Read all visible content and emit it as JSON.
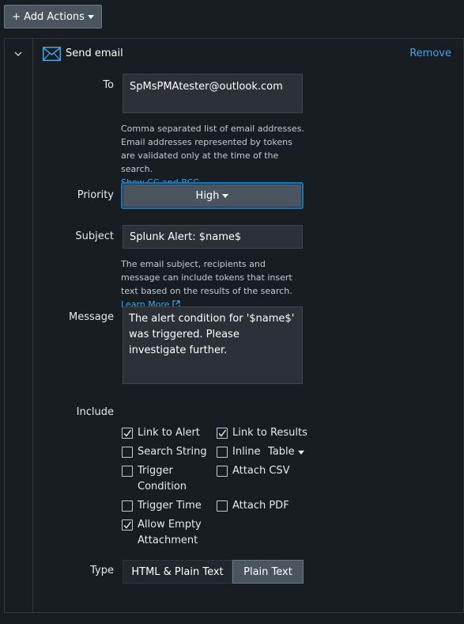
{
  "toolbar": {
    "add_actions_label": "+ Add Actions"
  },
  "action": {
    "title": "Send email",
    "remove_label": "Remove",
    "to": {
      "label": "To",
      "value": "SpMsPMAtester@outlook.com",
      "help": "Comma separated list of email addresses. Email addresses represented by tokens are validated only at the time of the search.",
      "show_cc_bcc": "Show CC and BCC"
    },
    "priority": {
      "label": "Priority",
      "value": "High"
    },
    "subject": {
      "label": "Subject",
      "value": "Splunk Alert: $name$",
      "help": "The email subject, recipients and message can include tokens that insert text based on the results of the search.",
      "learn_more": "Learn More"
    },
    "message": {
      "label": "Message",
      "value": "The alert condition for '$name$' was triggered. Please investigate further."
    },
    "include": {
      "label": "Include",
      "options": [
        {
          "label": "Link to Alert",
          "checked": true
        },
        {
          "label": "Link to Results",
          "checked": true
        },
        {
          "label": "Search String",
          "checked": false
        },
        {
          "label": "Inline",
          "checked": false
        },
        {
          "label": "Trigger Condition",
          "checked": false
        },
        {
          "label": "Attach CSV",
          "checked": false
        },
        {
          "label": "Trigger Time",
          "checked": false
        },
        {
          "label": "Attach PDF",
          "checked": false
        },
        {
          "label": "Allow Empty Attachment",
          "checked": true
        }
      ],
      "inline_format": "Table"
    },
    "type": {
      "label": "Type",
      "options": [
        "HTML & Plain Text",
        "Plain Text"
      ],
      "selected": "Plain Text"
    }
  },
  "colors": {
    "accent": "#1d74b5",
    "link": "#4aa3df",
    "background": "#171d21"
  }
}
